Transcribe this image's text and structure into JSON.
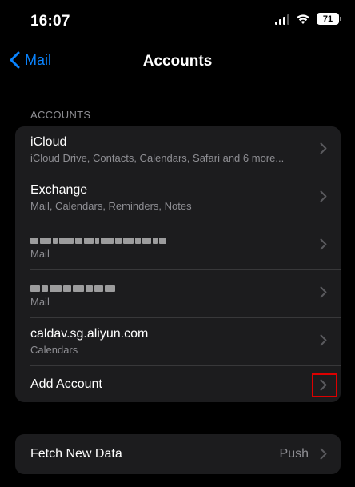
{
  "status_bar": {
    "time": "16:07",
    "battery": "71"
  },
  "nav": {
    "back_label": "Mail",
    "title": "Accounts"
  },
  "accounts_section": {
    "header": "ACCOUNTS",
    "items": [
      {
        "title": "iCloud",
        "subtitle": "iCloud Drive, Contacts, Calendars, Safari and 6 more..."
      },
      {
        "title": "Exchange",
        "subtitle": "Mail, Calendars, Reminders, Notes"
      },
      {
        "title": "",
        "subtitle": "Mail"
      },
      {
        "title": "",
        "subtitle": "Mail"
      },
      {
        "title": "caldav.sg.aliyun.com",
        "subtitle": "Calendars"
      }
    ],
    "add_account_label": "Add Account"
  },
  "fetch": {
    "label": "Fetch New Data",
    "value": "Push"
  },
  "colors": {
    "accent": "#0a84ff",
    "group_bg": "#1c1c1e",
    "secondary_text": "#8e8e93",
    "highlight": "#dd0000"
  },
  "icons": {
    "back": "chevron-left-icon",
    "disclosure": "chevron-right-icon",
    "wifi": "wifi-icon",
    "signal": "cellular-signal-icon",
    "battery": "battery-icon"
  }
}
